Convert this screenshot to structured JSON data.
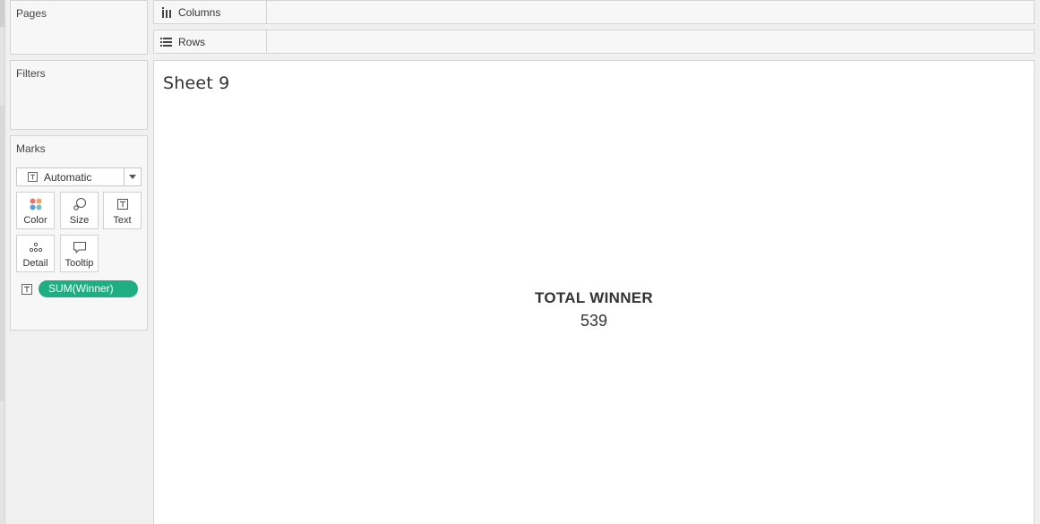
{
  "pages_card": {
    "title": "Pages"
  },
  "filters_card": {
    "title": "Filters"
  },
  "marks_card": {
    "title": "Marks",
    "mark_type": "Automatic",
    "buttons": {
      "color": "Color",
      "size": "Size",
      "text": "Text",
      "detail": "Detail",
      "tooltip": "Tooltip"
    },
    "pill": {
      "label": "SUM(Winner)",
      "color": "#1fae82",
      "icon": "text-icon"
    }
  },
  "shelves": {
    "columns": {
      "label": "Columns",
      "icon": "columns-icon"
    },
    "rows": {
      "label": "Rows",
      "icon": "rows-icon"
    }
  },
  "view": {
    "sheet_title": "Sheet 9",
    "kpi_label": "TOTAL WINNER",
    "kpi_value": "539"
  },
  "colors": {
    "pill_green": "#1fae82",
    "color_dots": [
      "#e8766f",
      "#5aa0d8",
      "#f0a860",
      "#7abfc3"
    ]
  }
}
